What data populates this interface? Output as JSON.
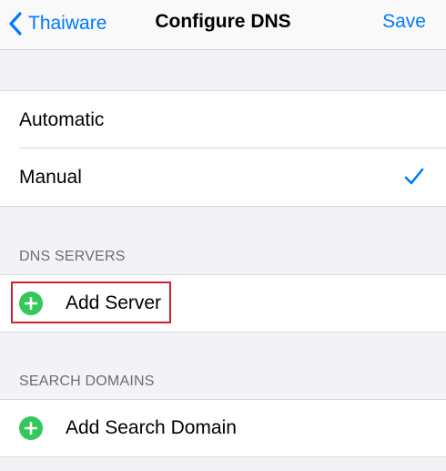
{
  "nav": {
    "back_label": "Thaiware",
    "title": "Configure DNS",
    "save_label": "Save"
  },
  "config_mode": {
    "options": [
      {
        "label": "Automatic",
        "selected": false
      },
      {
        "label": "Manual",
        "selected": true
      }
    ]
  },
  "dns_servers": {
    "header": "DNS SERVERS",
    "add_label": "Add Server"
  },
  "search_domains": {
    "header": "SEARCH DOMAINS",
    "add_label": "Add Search Domain"
  },
  "colors": {
    "accent": "#007aff",
    "add_green": "#34c759",
    "highlight_red": "#d0202a",
    "grouped_background": "#f2f2f7"
  },
  "icons": {
    "back": "chevron-left-icon",
    "selected": "checkmark-icon",
    "add": "plus-circle-icon"
  }
}
